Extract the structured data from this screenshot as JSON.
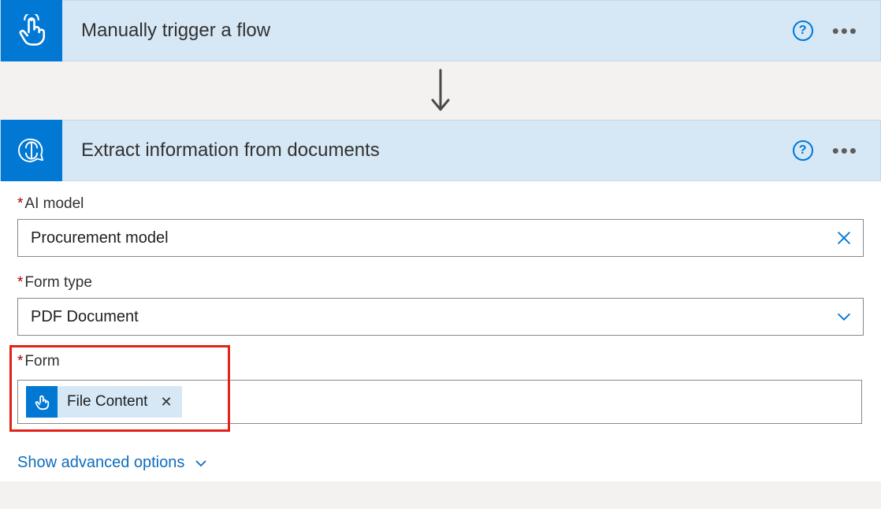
{
  "trigger": {
    "title": "Manually trigger a flow"
  },
  "action": {
    "title": "Extract information from documents",
    "fields": {
      "ai_model": {
        "label": "AI model",
        "value": "Procurement model"
      },
      "form_type": {
        "label": "Form type",
        "value": "PDF Document"
      },
      "form": {
        "label": "Form",
        "token": "File Content"
      }
    },
    "advanced_link": "Show advanced options"
  }
}
